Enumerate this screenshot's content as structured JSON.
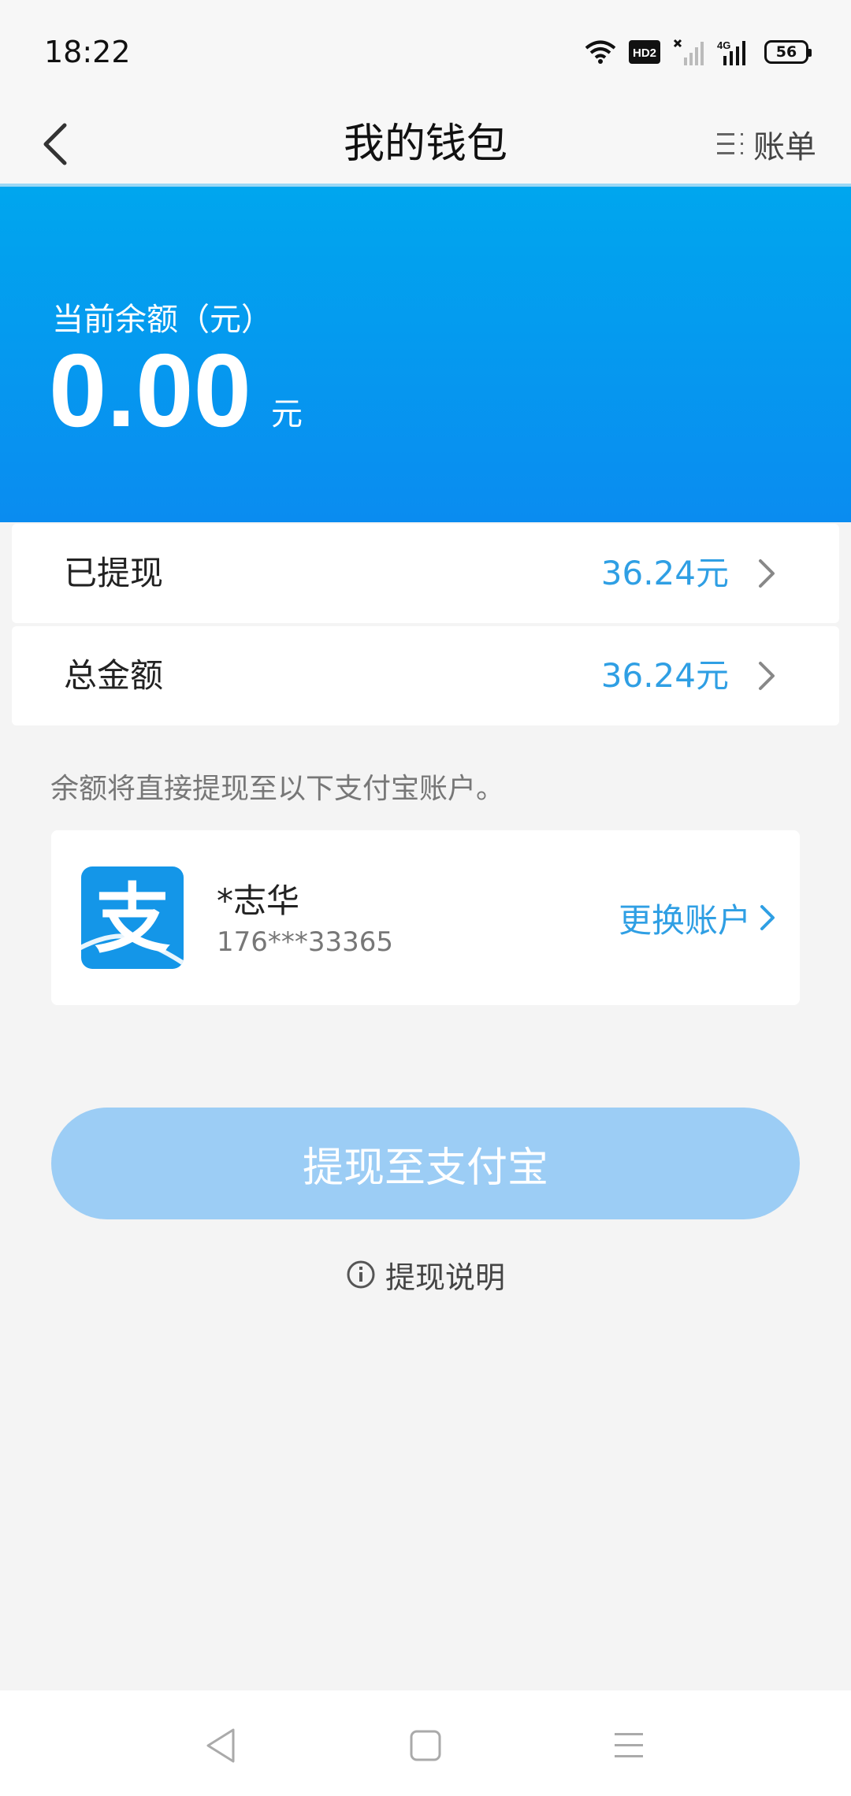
{
  "status_bar": {
    "time": "18:22",
    "hd_label": "HD2",
    "network_label": "4G",
    "battery": "56"
  },
  "header": {
    "title": "我的钱包",
    "bill_label": "账单"
  },
  "balance": {
    "label": "当前余额（元）",
    "amount": "0.00",
    "unit": "元"
  },
  "rows": [
    {
      "label": "已提现",
      "value": "36.24元"
    },
    {
      "label": "总金额",
      "value": "36.24元"
    }
  ],
  "hint": "余额将直接提现至以下支付宝账户。",
  "account": {
    "logo_glyph": "支",
    "name": "*志华",
    "phone": "176***33365",
    "change_label": "更换账户"
  },
  "withdraw_button": "提现至支付宝",
  "withdraw_info": "提现说明",
  "colors": {
    "accent": "#2f9fe4",
    "banner_top": "#00a6ee",
    "banner_bottom": "#0a8cf0",
    "button_disabled": "#9ccdf5",
    "alipay_blue": "#1496e8"
  }
}
